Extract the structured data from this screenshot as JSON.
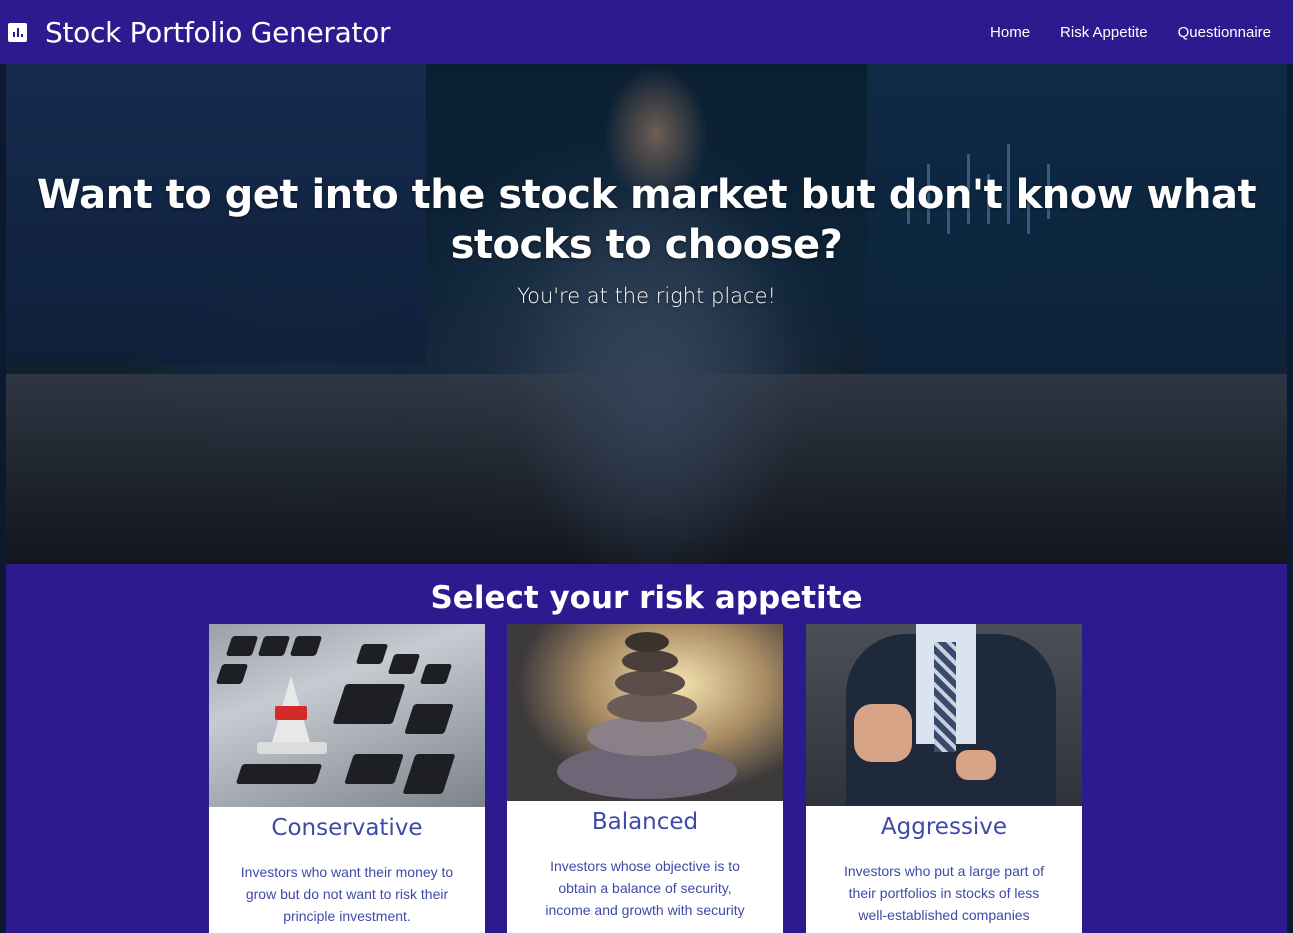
{
  "navbar": {
    "brand_icon": "bar-chart-icon",
    "title": "Stock Portfolio Generator",
    "links": [
      {
        "label": "Home"
      },
      {
        "label": "Risk Appetite"
      },
      {
        "label": "Questionnaire"
      }
    ]
  },
  "hero": {
    "title": "Want to get into the stock market but don't know what stocks to choose?",
    "subtitle": "You're at the right place!"
  },
  "risk": {
    "heading": "Select your risk appetite",
    "cards": [
      {
        "title": "Conservative",
        "description": "Investors who want their money to grow but do not want to risk their principle investment."
      },
      {
        "title": "Balanced",
        "description": "Investors whose objective is to obtain a balance of security, income and growth with security"
      },
      {
        "title": "Aggressive",
        "description": "Investors who put a large part of their portfolios in stocks of less well-established companies"
      }
    ]
  },
  "colors": {
    "primary": "#2e1a8f",
    "card_text": "#3e4aa8",
    "white": "#ffffff"
  }
}
